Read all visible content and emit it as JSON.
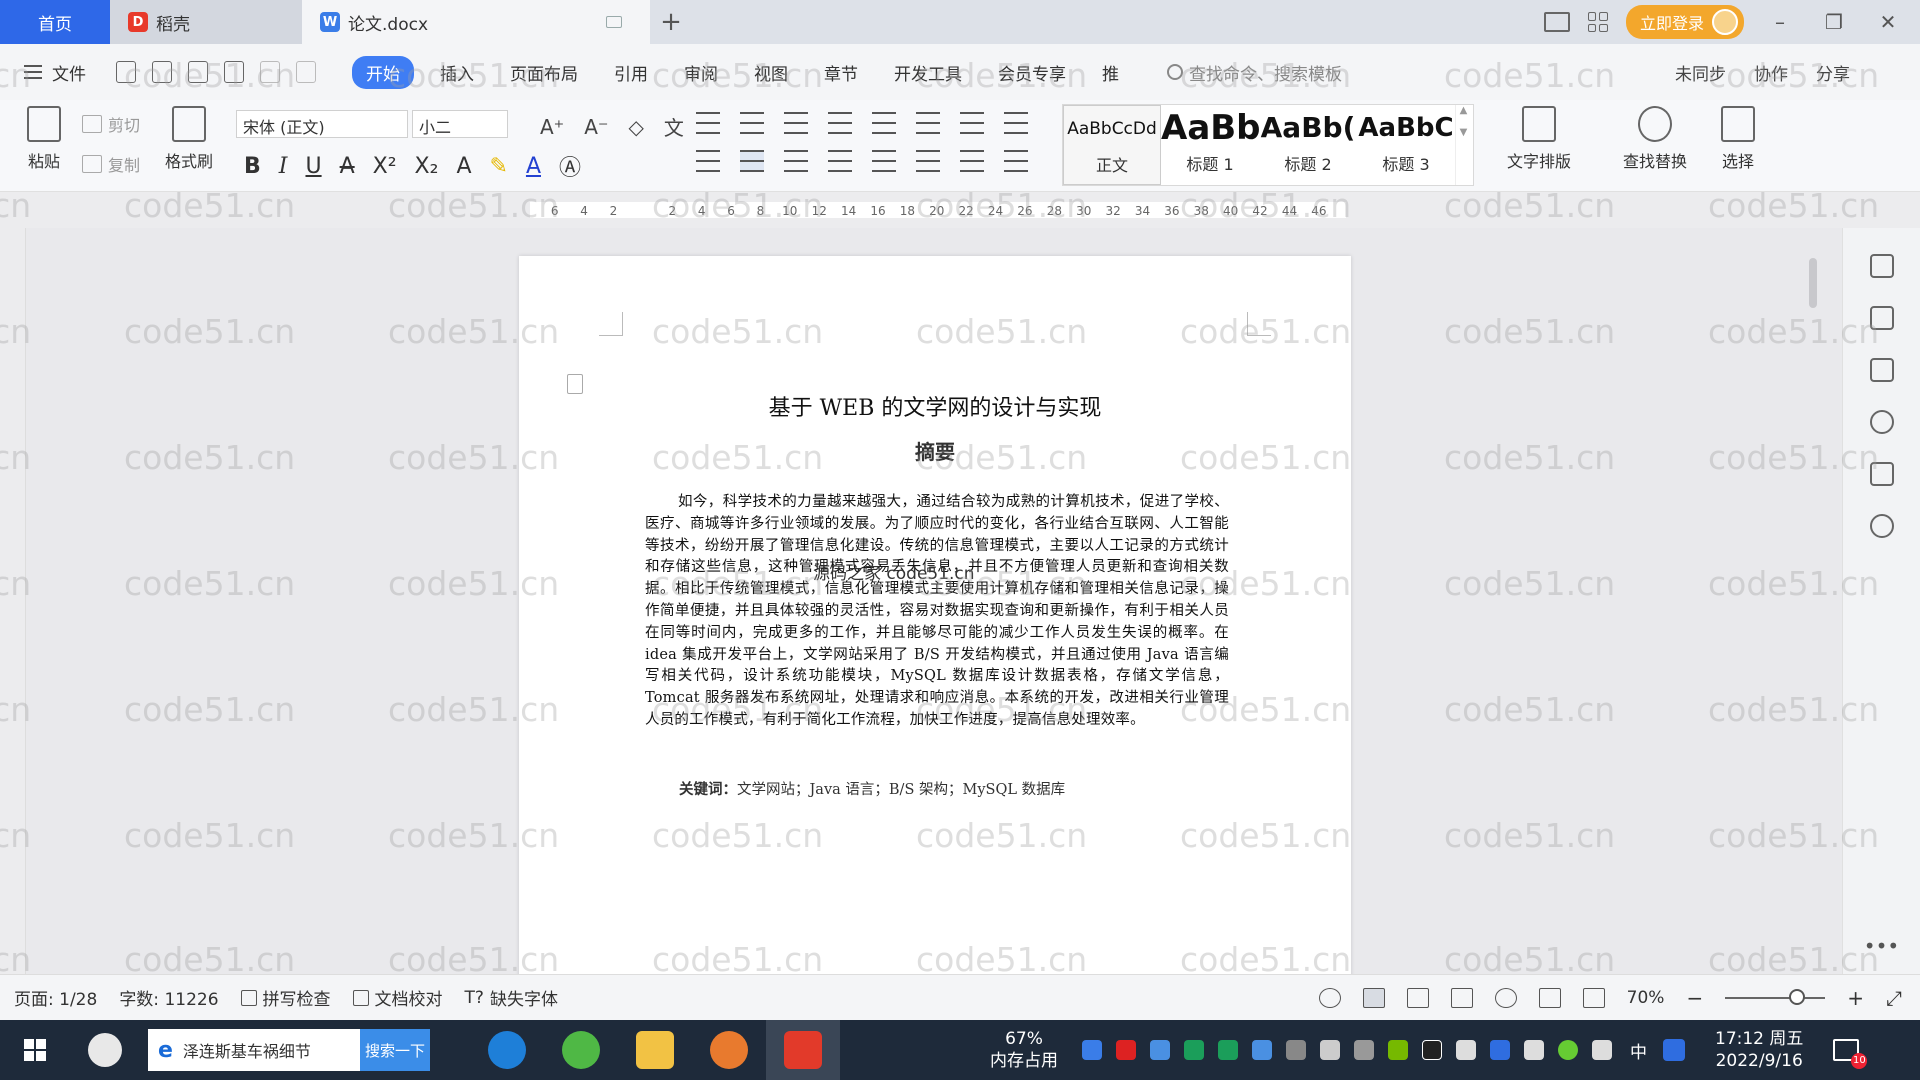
{
  "titlebar": {
    "home_tab": "首页",
    "tabs": [
      {
        "label": "稻壳",
        "logo_color": "#e8392a"
      },
      {
        "label": "论文.docx",
        "logo_color": "#3a7de8"
      }
    ],
    "login_label": "立即登录"
  },
  "menubar": {
    "file_label": "文件",
    "items": [
      "开始",
      "插入",
      "页面布局",
      "引用",
      "审阅",
      "视图",
      "章节",
      "开发工具",
      "会员专享",
      "推"
    ],
    "search_placeholder": "查找命令、搜索模板",
    "right": [
      "未同步",
      "协作",
      "分享"
    ]
  },
  "ribbon": {
    "paste": "粘贴",
    "cut": "剪切",
    "copy": "复制",
    "format_painter": "格式刷",
    "font_name": "宋体 (正文)",
    "font_size": "小二",
    "styles": [
      {
        "preview": "AaBbCcDd",
        "label": "正文"
      },
      {
        "preview": "AaBb",
        "label": "标题 1"
      },
      {
        "preview": "AaBb(",
        "label": "标题 2"
      },
      {
        "preview": "AaBbC",
        "label": "标题 3"
      }
    ],
    "text_layout": "文字排版",
    "find_replace": "查找替换",
    "select": "选择"
  },
  "ruler": {
    "numbers": [
      "6",
      "4",
      "2",
      "",
      "2",
      "4",
      "6",
      "8",
      "10",
      "12",
      "14",
      "16",
      "18",
      "20",
      "22",
      "24",
      "26",
      "28",
      "30",
      "32",
      "34",
      "36",
      "38",
      "40",
      "42",
      "44",
      "46"
    ]
  },
  "document": {
    "title": "基于 WEB 的文学网的设计与实现",
    "abstract_heading": "摘要",
    "body": "如今，科学技术的力量越来越强大，通过结合较为成熟的计算机技术，促进了学校、医疗、商城等许多行业领域的发展。为了顺应时代的变化，各行业结合互联网、人工智能等技术，纷纷开展了管理信息化建设。传统的信息管理模式，主要以人工记录的方式统计和存储这些信息，这种管理模式容易丢失信息，并且不方便管理人员更新和查询相关数据。相比于传统管理模式，信息化管理模式主要使用计算机存储和管理相关信息记录，操作简单便捷，并且具体较强的灵活性，容易对数据实现查询和更新操作，有利于相关人员在同等时间内，完成更多的工作，并且能够尽可能的减少工作人员发生失误的概率。在 idea 集成开发平台上，文学网站采用了 B/S 开发结构模式，并且通过使用 Java 语言编写相关代码，设计系统功能模块，MySQL 数据库设计数据表格，存储文学信息，Tomcat 服务器发布系统网址，处理请求和响应消息。本系统的开发，改进相关行业管理人员的工作模式，有利于简化工作流程，加快工作进度，提高信息处理效率。",
    "keywords_label": "关键词：",
    "keywords": "文学网站；Java 语言；B/S 架构；MySQL 数据库",
    "overlay": "源码之家 code51.cn"
  },
  "watermark": "code51.cn",
  "statusbar": {
    "page": "页面: 1/28",
    "words": "字数: 11226",
    "spell_check": "拼写检查",
    "doc_proof": "文档校对",
    "missing_font": "缺失字体",
    "zoom": "70%",
    "zoom_level": 0.7
  },
  "taskbar": {
    "search_text": "泽连斯基车祸细节",
    "search_button": "搜索一下",
    "memory_percent": "67%",
    "memory_label": "内存占用",
    "time": "17:12 周五",
    "date": "2022/9/16",
    "ime": "中",
    "notification_count": "10"
  }
}
